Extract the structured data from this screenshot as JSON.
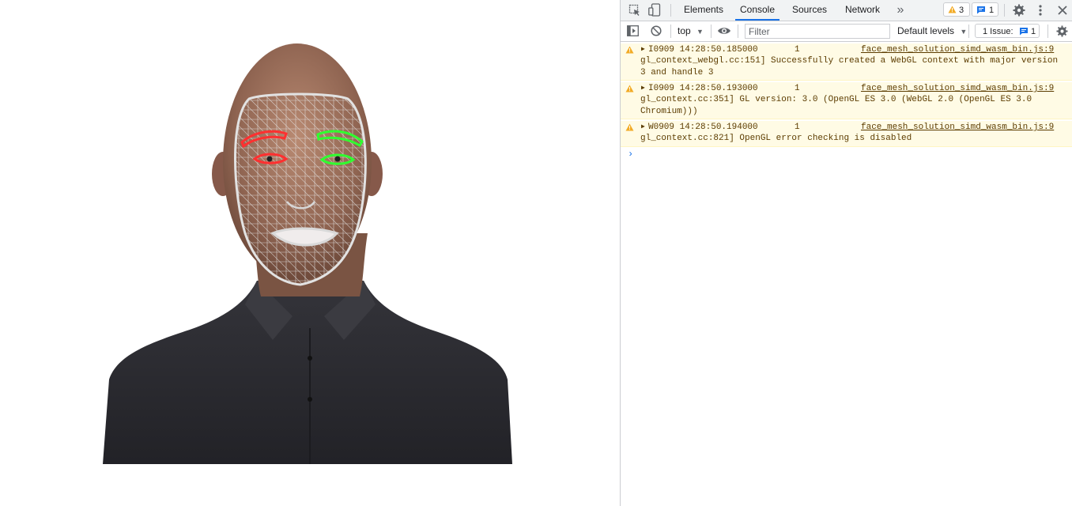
{
  "devtools": {
    "tabs": [
      {
        "label": "Elements",
        "active": false
      },
      {
        "label": "Console",
        "active": true
      },
      {
        "label": "Sources",
        "active": false
      },
      {
        "label": "Network",
        "active": false
      }
    ],
    "more_tabs": "»",
    "warning_count": "3",
    "message_count": "1",
    "toolbar": {
      "context": "top",
      "filter_placeholder": "Filter",
      "levels": "Default levels",
      "issues_label": "1 Issue:",
      "issues_count": "1"
    },
    "colors": {
      "accent": "#1a73e8",
      "warning_bg": "#fffbe5",
      "warning_text": "#5c3c00",
      "warning_icon": "#f2ab26",
      "right_eye": "#ff3030",
      "left_eye": "#30ff30",
      "mesh": "#e0e0e0"
    },
    "messages": [
      {
        "head": "I0909 14:28:50.185000",
        "count": "1",
        "source": "face_mesh_solution_simd_wasm_bin.js:9",
        "body": "gl_context_webgl.cc:151] Successfully created a WebGL context with major version 3 and handle 3"
      },
      {
        "head": "I0909 14:28:50.193000",
        "count": "1",
        "source": "face_mesh_solution_simd_wasm_bin.js:9",
        "body": "gl_context.cc:351] GL version: 3.0 (OpenGL ES 3.0 (WebGL 2.0 (OpenGL ES 3.0 Chromium)))"
      },
      {
        "head": "W0909 14:28:50.194000",
        "count": "1",
        "source": "face_mesh_solution_simd_wasm_bin.js:9",
        "body": "gl_context.cc:821] OpenGL error checking is disabled"
      }
    ],
    "prompt_symbol": "›"
  }
}
